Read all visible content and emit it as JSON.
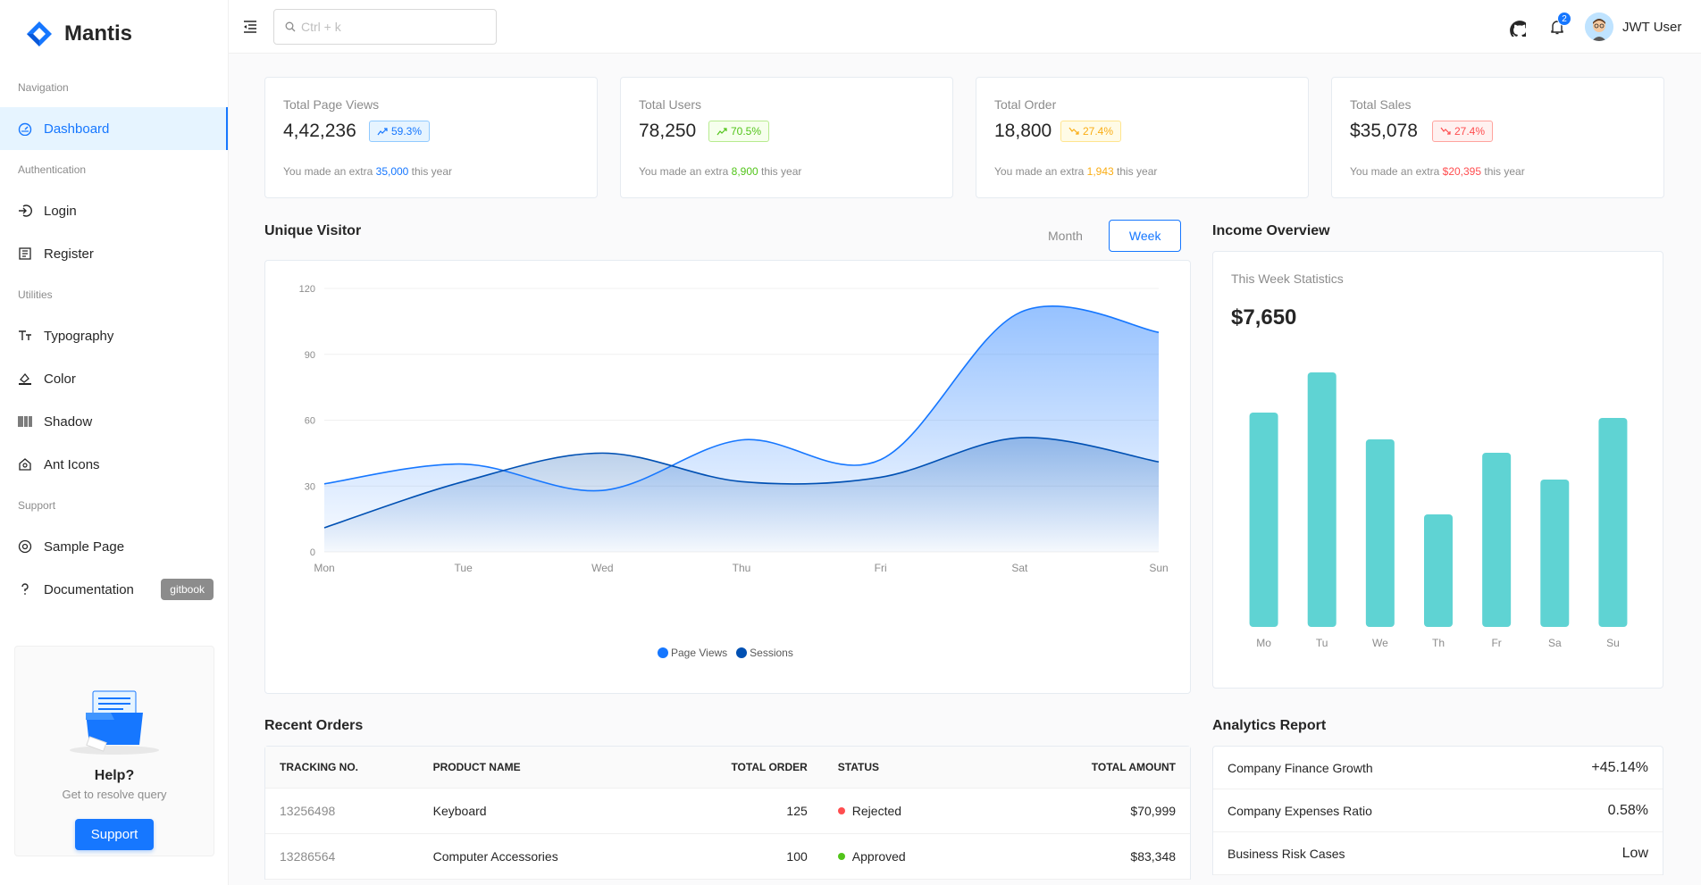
{
  "brand": {
    "name": "Mantis"
  },
  "sidebar": {
    "groups": [
      {
        "title": "Navigation",
        "items": [
          {
            "label": "Dashboard",
            "icon": "dashboard-icon"
          }
        ]
      },
      {
        "title": "Authentication",
        "items": [
          {
            "label": "Login",
            "icon": "login-icon"
          },
          {
            "label": "Register",
            "icon": "register-icon"
          }
        ]
      },
      {
        "title": "Utilities",
        "items": [
          {
            "label": "Typography",
            "icon": "typography-icon"
          },
          {
            "label": "Color",
            "icon": "color-icon"
          },
          {
            "label": "Shadow",
            "icon": "barcode-icon"
          },
          {
            "label": "Ant Icons",
            "icon": "ant-icons-icon"
          }
        ]
      },
      {
        "title": "Support",
        "items": [
          {
            "label": "Sample Page",
            "icon": "chrome-icon"
          },
          {
            "label": "Documentation",
            "icon": "question-icon",
            "chip": "gitbook"
          }
        ]
      }
    ],
    "help": {
      "title": "Help?",
      "subtitle": "Get to resolve query",
      "button": "Support"
    }
  },
  "header": {
    "search_placeholder": "Ctrl + k",
    "notification_count": "2",
    "user_name": "JWT User"
  },
  "stats": [
    {
      "label": "Total Page Views",
      "value": "4,42,236",
      "change": "59.3%",
      "trend": "up",
      "color": "blue",
      "foot_pre": "You made an extra ",
      "foot_value": "35,000",
      "foot_post": " this year"
    },
    {
      "label": "Total Users",
      "value": "78,250",
      "change": "70.5%",
      "trend": "up",
      "color": "green",
      "foot_pre": "You made an extra ",
      "foot_value": "8,900",
      "foot_post": " this year"
    },
    {
      "label": "Total Order",
      "value": "18,800",
      "change": "27.4%",
      "trend": "down",
      "color": "orange",
      "foot_pre": "You made an extra ",
      "foot_value": "1,943",
      "foot_post": " this year"
    },
    {
      "label": "Total Sales",
      "value": "$35,078",
      "change": "27.4%",
      "trend": "down",
      "color": "red",
      "foot_pre": "You made an extra ",
      "foot_value": "$20,395",
      "foot_post": " this year"
    }
  ],
  "unique_visitor": {
    "title": "Unique Visitor",
    "toggle": {
      "month": "Month",
      "week": "Week",
      "selected": "Week"
    }
  },
  "income_overview": {
    "title": "Income Overview",
    "subtitle": "This Week Statistics",
    "value": "$7,650"
  },
  "chart_data": [
    {
      "type": "area",
      "categories": [
        "Mon",
        "Tue",
        "Wed",
        "Thu",
        "Fri",
        "Sat",
        "Sun"
      ],
      "series": [
        {
          "name": "Page Views",
          "values": [
            31,
            40,
            28,
            51,
            42,
            109,
            100
          ],
          "color": "#1677ff"
        },
        {
          "name": "Sessions",
          "values": [
            11,
            32,
            45,
            32,
            34,
            52,
            41
          ],
          "color": "#0050b3"
        }
      ],
      "ylim": [
        0,
        120
      ],
      "yticks": [
        0,
        30,
        60,
        90,
        120
      ],
      "grid": true,
      "legend": "bottom"
    },
    {
      "type": "bar",
      "categories": [
        "Mo",
        "Tu",
        "We",
        "Th",
        "Fr",
        "Sa",
        "Su"
      ],
      "values": [
        80,
        95,
        70,
        42,
        65,
        55,
        78
      ],
      "color": "#13c2c2",
      "grid": false
    }
  ],
  "recent_orders": {
    "title": "Recent Orders",
    "columns": [
      "TRACKING NO.",
      "PRODUCT NAME",
      "TOTAL ORDER",
      "STATUS",
      "TOTAL AMOUNT"
    ],
    "rows": [
      {
        "tracking": "13256498",
        "product": "Keyboard",
        "total": "125",
        "status": "Rejected",
        "status_color": "#ff4d4f",
        "amount": "$70,999"
      },
      {
        "tracking": "13286564",
        "product": "Computer Accessories",
        "total": "100",
        "status": "Approved",
        "status_color": "#52c41a",
        "amount": "$83,348"
      }
    ]
  },
  "analytics_report": {
    "title": "Analytics Report",
    "rows": [
      {
        "label": "Company Finance Growth",
        "value": "+45.14%"
      },
      {
        "label": "Company Expenses Ratio",
        "value": "0.58%"
      },
      {
        "label": "Business Risk Cases",
        "value": "Low"
      }
    ]
  }
}
